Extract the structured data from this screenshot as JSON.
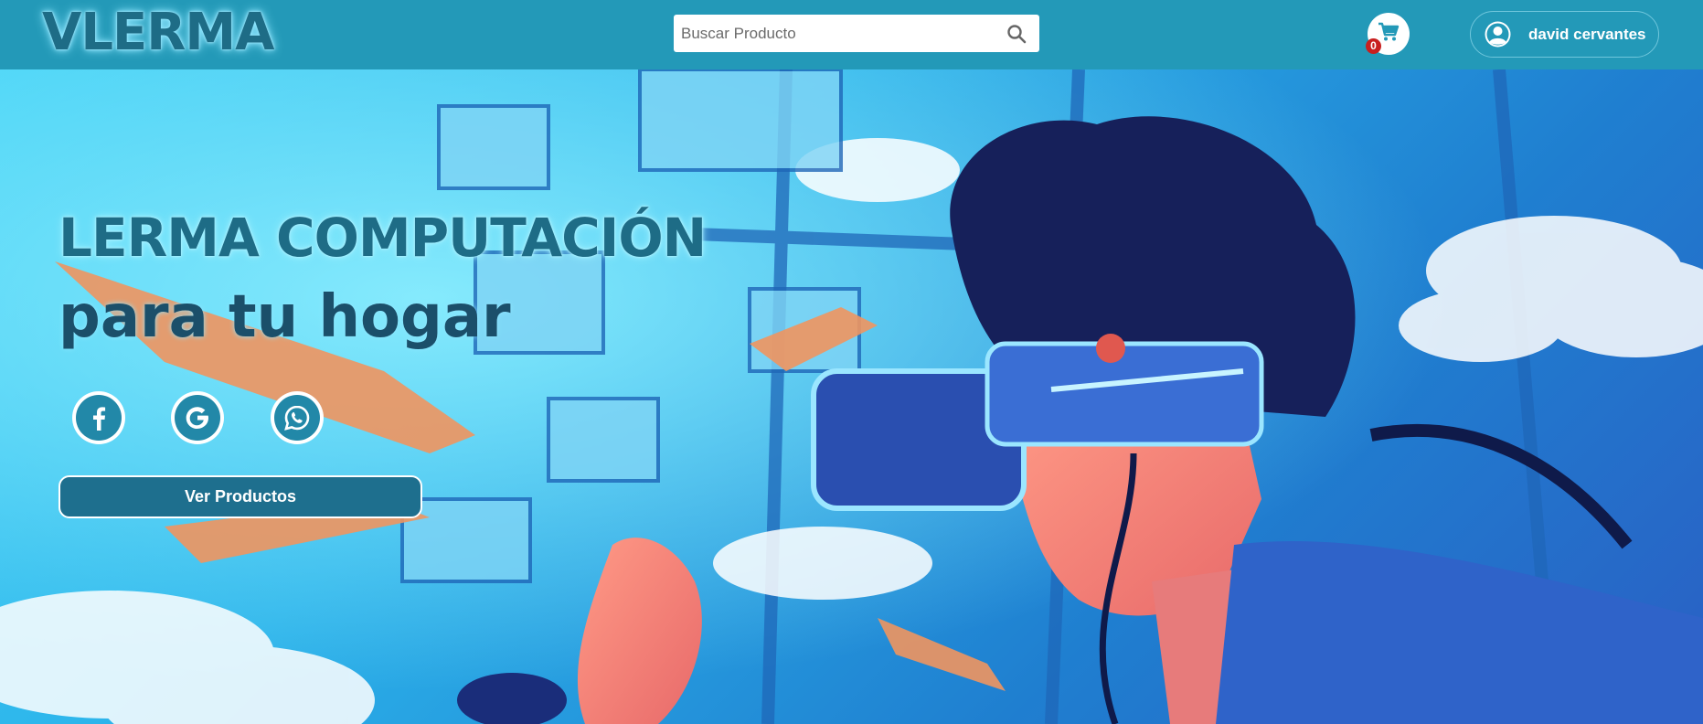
{
  "header": {
    "logo": "VLERMA",
    "search": {
      "placeholder": "Buscar Producto",
      "value": ""
    },
    "cart": {
      "count": "0",
      "icon": "cart-icon"
    },
    "user": {
      "name": "david cervantes",
      "icon": "user-circle-icon"
    }
  },
  "hero": {
    "title": "LERMA COMPUTACIÓN",
    "subtitle": "para tu hogar",
    "social": [
      {
        "name": "facebook",
        "icon": "facebook-icon"
      },
      {
        "name": "google",
        "icon": "google-icon"
      },
      {
        "name": "whatsapp",
        "icon": "whatsapp-icon"
      }
    ],
    "cta_label": "Ver Productos"
  },
  "colors": {
    "header_bg": "#2399b8",
    "brand_dark": "#1e6c86",
    "cta_bg": "#1e6f8e",
    "badge": "#c81f1f"
  }
}
